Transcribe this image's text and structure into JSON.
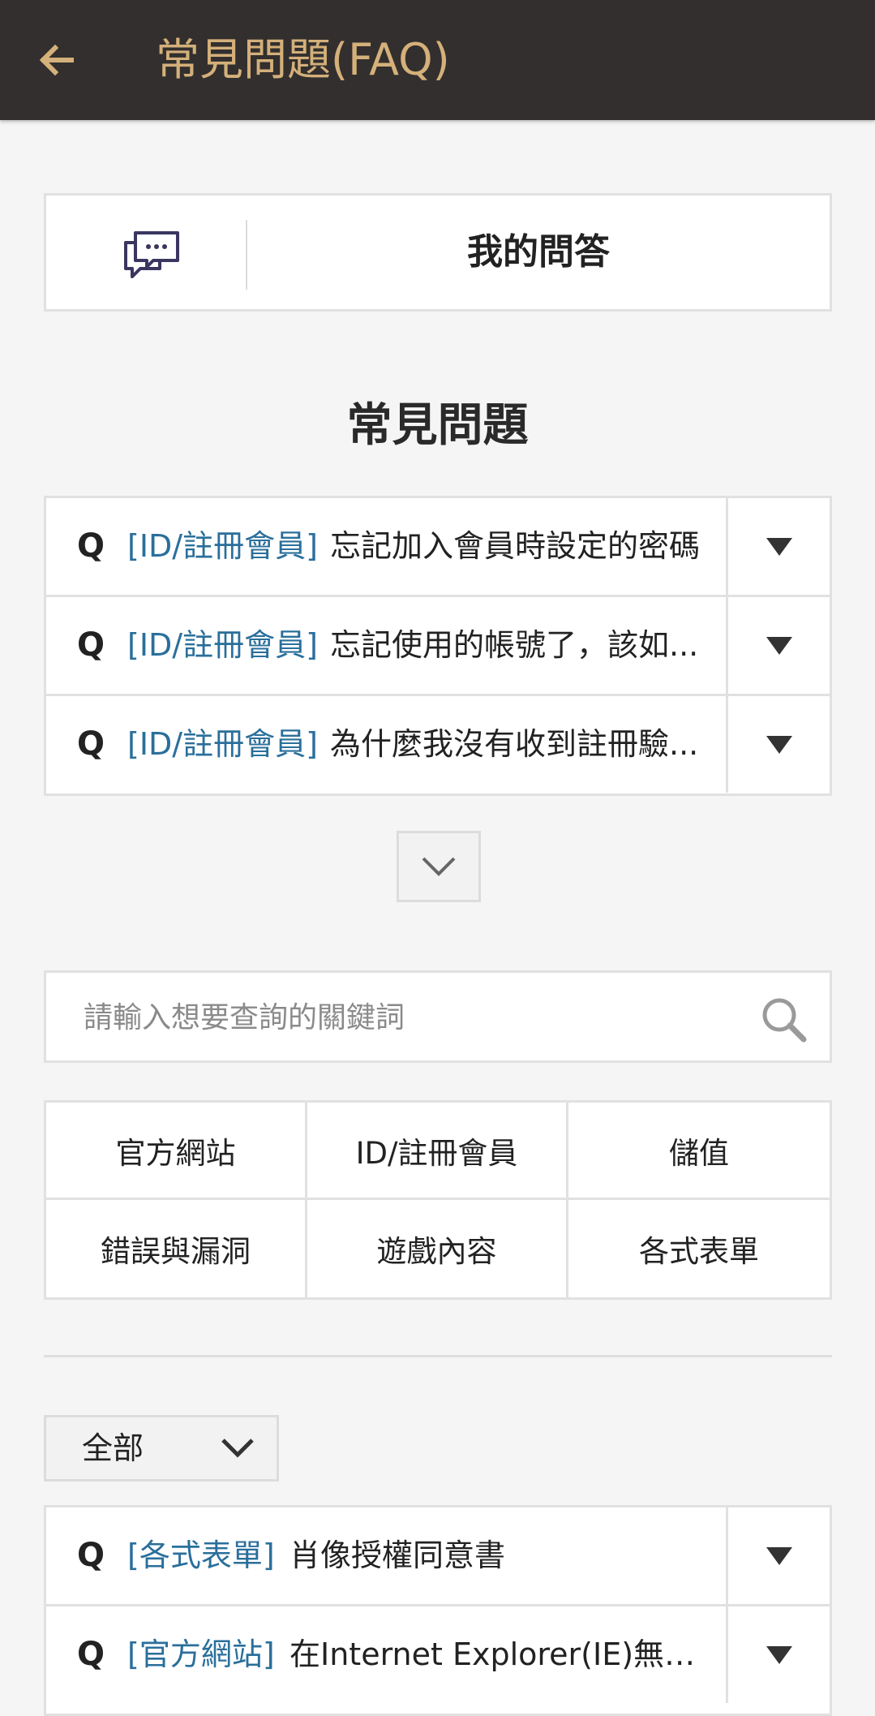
{
  "header": {
    "title": "常見問題(FAQ)",
    "back_icon": "arrow-left-icon"
  },
  "my_qa": {
    "label": "我的問答",
    "icon": "chat-bubbles-icon"
  },
  "faq_section": {
    "title": "常見問題",
    "items": [
      {
        "q": "Q",
        "category": "[ID/註冊會員]",
        "text": "忘記加入會員時設定的密碼"
      },
      {
        "q": "Q",
        "category": "[ID/註冊會員]",
        "text": "忘記使用的帳號了，該如..."
      },
      {
        "q": "Q",
        "category": "[ID/註冊會員]",
        "text": "為什麼我沒有收到註冊驗..."
      }
    ],
    "more_icon": "chevron-down-icon"
  },
  "search": {
    "placeholder": "請輸入想要查詢的關鍵詞",
    "value": "",
    "icon": "search-icon"
  },
  "categories": [
    "官方網站",
    "ID/註冊會員",
    "儲值",
    "錯誤與漏洞",
    "遊戲內容",
    "各式表單"
  ],
  "filter": {
    "selected": "全部"
  },
  "list": {
    "items": [
      {
        "q": "Q",
        "category": "[各式表單]",
        "text": "肖像授權同意書"
      },
      {
        "q": "Q",
        "category": "[官方網站]",
        "text": "在Internet Explorer(IE)無法..."
      }
    ]
  },
  "colors": {
    "header_bg": "#322f2e",
    "header_text": "#d4b07a",
    "category_text": "#2a6f9b",
    "page_bg": "#f5f5f5"
  }
}
